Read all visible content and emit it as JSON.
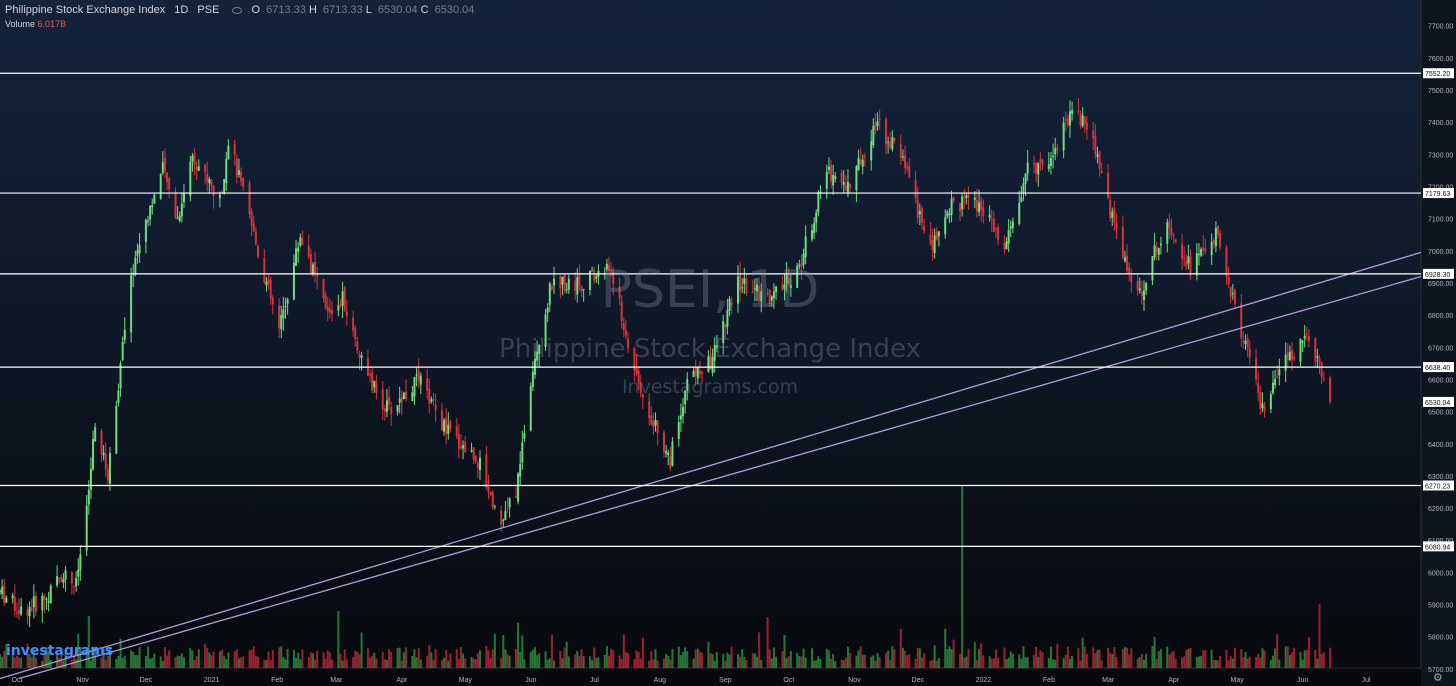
{
  "header": {
    "title": "Philippine Stock Exchange Index",
    "interval": "1D",
    "exchange": "PSE",
    "ohlc": [
      {
        "k": "O",
        "v": "6713.33"
      },
      {
        "k": "H",
        "v": "6713.33"
      },
      {
        "k": "L",
        "v": "6530.04"
      },
      {
        "k": "C",
        "v": "6530.04"
      }
    ],
    "volume_label": "Volume",
    "volume_value": "6.017B"
  },
  "watermark": {
    "symbol": "PSEI, 1D",
    "name": "Philippine Stock Exchange Index",
    "site": "Investagrams.com"
  },
  "logo_text": "investagrams",
  "settings_icon": "gear-icon",
  "colors": {
    "up": "#26a69a",
    "up_candle": "#6fdc7f",
    "down": "#ef5350",
    "down_candle": "#d7323c",
    "vol_up": "#2b8a3e",
    "vol_down": "#b3263a",
    "level_line": "#ffffff",
    "trend_line": "#b39ddb",
    "axis_text": "#b2b5be"
  },
  "chart_data": {
    "type": "candlestick",
    "title": "Philippine Stock Exchange Index",
    "y_axis": {
      "range": [
        5670,
        7770
      ],
      "ticks": [
        5700,
        5800,
        5900,
        6000,
        6100,
        6200,
        6300,
        6400,
        6500,
        6600,
        6700,
        6800,
        6900,
        7000,
        7100,
        7200,
        7300,
        7400,
        7500,
        7600,
        7700
      ],
      "tick_labels": [
        "5700.00",
        "5800.00",
        "5900.00",
        "6000.00",
        "6100.00",
        "6200.00",
        "6300.00",
        "6400.00",
        "6500.00",
        "6600.00",
        "6700.00",
        "6800.00",
        "6900.00",
        "7000.00",
        "7100.00",
        "7200.00",
        "7300.00",
        "7400.00",
        "7500.00",
        "7600.00",
        "7700.00"
      ]
    },
    "x_axis": {
      "labels": [
        "Oct",
        "Nov",
        "Dec",
        "2021",
        "Feb",
        "Mar",
        "Apr",
        "May",
        "Jun",
        "Jul",
        "Aug",
        "Sep",
        "Oct",
        "Nov",
        "Dec",
        "2022",
        "Feb",
        "Mar",
        "Apr",
        "May",
        "Jun",
        "Jul"
      ]
    },
    "grid": false,
    "horizontal_levels": [
      {
        "value": 7552.2,
        "label": "7552.20"
      },
      {
        "value": 7179.63,
        "label": "7179.63"
      },
      {
        "value": 6928.3,
        "label": "6928.30"
      },
      {
        "value": 6638.4,
        "label": "6638.40"
      },
      {
        "value": 6270.23,
        "label": "6270.23"
      },
      {
        "value": 6080.94,
        "label": "6080.94"
      }
    ],
    "last_price": {
      "value": 6530.04,
      "label": "6530.04"
    },
    "trend_lines": [
      {
        "from": {
          "date": "2020-09-22",
          "value": 5670
        },
        "to": {
          "date": "2022-07-26",
          "value": 6995
        }
      },
      {
        "from": {
          "date": "2020-10-01",
          "value": 5670
        },
        "to": {
          "date": "2022-07-26",
          "value": 6920
        }
      }
    ],
    "price_path": [
      {
        "date": "2020-09-22",
        "value": 5940
      },
      {
        "date": "2020-10-02",
        "value": 5880
      },
      {
        "date": "2020-10-14",
        "value": 5920
      },
      {
        "date": "2020-10-22",
        "value": 6000
      },
      {
        "date": "2020-10-28",
        "value": 5960
      },
      {
        "date": "2020-11-02",
        "value": 6200
      },
      {
        "date": "2020-11-06",
        "value": 6450
      },
      {
        "date": "2020-11-12",
        "value": 6300
      },
      {
        "date": "2020-11-18",
        "value": 6650
      },
      {
        "date": "2020-11-24",
        "value": 6950
      },
      {
        "date": "2020-11-30",
        "value": 7100
      },
      {
        "date": "2020-12-08",
        "value": 7250
      },
      {
        "date": "2020-12-15",
        "value": 7100
      },
      {
        "date": "2020-12-22",
        "value": 7300
      },
      {
        "date": "2021-01-04",
        "value": 7150
      },
      {
        "date": "2021-01-08",
        "value": 7350
      },
      {
        "date": "2021-01-20",
        "value": 7050
      },
      {
        "date": "2021-02-01",
        "value": 6750
      },
      {
        "date": "2021-02-11",
        "value": 7050
      },
      {
        "date": "2021-02-24",
        "value": 6800
      },
      {
        "date": "2021-03-03",
        "value": 6850
      },
      {
        "date": "2021-03-15",
        "value": 6600
      },
      {
        "date": "2021-03-25",
        "value": 6500
      },
      {
        "date": "2021-04-08",
        "value": 6600
      },
      {
        "date": "2021-04-20",
        "value": 6450
      },
      {
        "date": "2021-05-06",
        "value": 6350
      },
      {
        "date": "2021-05-17",
        "value": 6150
      },
      {
        "date": "2021-05-24",
        "value": 6250
      },
      {
        "date": "2021-06-01",
        "value": 6650
      },
      {
        "date": "2021-06-10",
        "value": 6900
      },
      {
        "date": "2021-06-24",
        "value": 6900
      },
      {
        "date": "2021-07-08",
        "value": 6950
      },
      {
        "date": "2021-07-16",
        "value": 6700
      },
      {
        "date": "2021-07-26",
        "value": 6500
      },
      {
        "date": "2021-08-05",
        "value": 6350
      },
      {
        "date": "2021-08-13",
        "value": 6600
      },
      {
        "date": "2021-08-24",
        "value": 6650
      },
      {
        "date": "2021-09-06",
        "value": 6900
      },
      {
        "date": "2021-09-22",
        "value": 6850
      },
      {
        "date": "2021-10-05",
        "value": 6950
      },
      {
        "date": "2021-10-18",
        "value": 7250
      },
      {
        "date": "2021-10-29",
        "value": 7200
      },
      {
        "date": "2021-11-10",
        "value": 7400
      },
      {
        "date": "2021-11-22",
        "value": 7300
      },
      {
        "date": "2021-12-06",
        "value": 7000
      },
      {
        "date": "2021-12-16",
        "value": 7150
      },
      {
        "date": "2021-12-29",
        "value": 7150
      },
      {
        "date": "2022-01-10",
        "value": 7000
      },
      {
        "date": "2022-01-21",
        "value": 7250
      },
      {
        "date": "2022-02-02",
        "value": 7300
      },
      {
        "date": "2022-02-11",
        "value": 7450
      },
      {
        "date": "2022-02-21",
        "value": 7350
      },
      {
        "date": "2022-03-02",
        "value": 7100
      },
      {
        "date": "2022-03-14",
        "value": 6850
      },
      {
        "date": "2022-03-28",
        "value": 7100
      },
      {
        "date": "2022-04-08",
        "value": 6950
      },
      {
        "date": "2022-04-20",
        "value": 7050
      },
      {
        "date": "2022-05-02",
        "value": 6750
      },
      {
        "date": "2022-05-12",
        "value": 6500
      },
      {
        "date": "2022-05-23",
        "value": 6650
      },
      {
        "date": "2022-06-02",
        "value": 6750
      },
      {
        "date": "2022-06-13",
        "value": 6530.04
      }
    ],
    "volume": {
      "unit": "B",
      "spikes": [
        {
          "date": "2020-11-03",
          "value": 4.5
        },
        {
          "date": "2021-03-01",
          "value": 4.9
        },
        {
          "date": "2021-05-25",
          "value": 3.9
        },
        {
          "date": "2021-09-20",
          "value": 4.4
        },
        {
          "date": "2021-12-21",
          "value": 15.7
        },
        {
          "date": "2022-06-08",
          "value": 5.5
        }
      ],
      "last": 6.017
    }
  }
}
